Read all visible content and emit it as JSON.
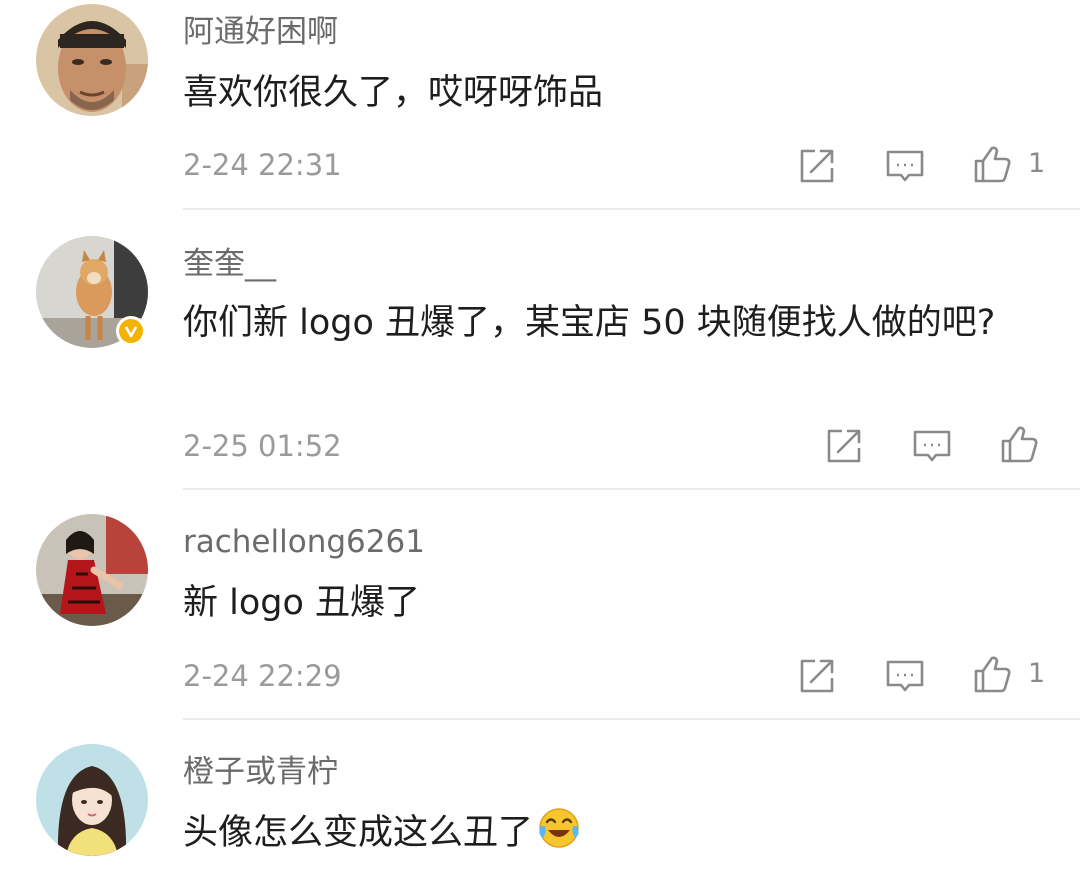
{
  "comments": [
    {
      "username": "阿通好困啊",
      "content": "喜欢你很久了，哎呀呀饰品",
      "timestamp": "2-24 22:31",
      "likes": "1",
      "verified": false
    },
    {
      "username": "奎奎__",
      "content": "你们新 logo 丑爆了，某宝店 50 块随便找人做的吧?",
      "timestamp": "2-25 01:52",
      "likes": "",
      "verified": true
    },
    {
      "username": "rachellong6261",
      "content": "新 logo 丑爆了",
      "timestamp": "2-24 22:29",
      "likes": "1",
      "verified": false
    },
    {
      "username": "橙子或青柠",
      "content": "头像怎么变成这么丑了",
      "emoji": "crying-laughing-emoji",
      "verified": false
    }
  ],
  "icons": {
    "share": "share-icon",
    "reply": "comment-icon",
    "like": "thumbs-up-icon",
    "verified": "verified-badge-icon"
  },
  "colors": {
    "username": "#6b6b6b",
    "content": "#1e1e1e",
    "timestamp": "#9a9a9a",
    "icon": "#8a8a8a",
    "verified_badge": "#f5b301",
    "divider": "#ececec"
  }
}
